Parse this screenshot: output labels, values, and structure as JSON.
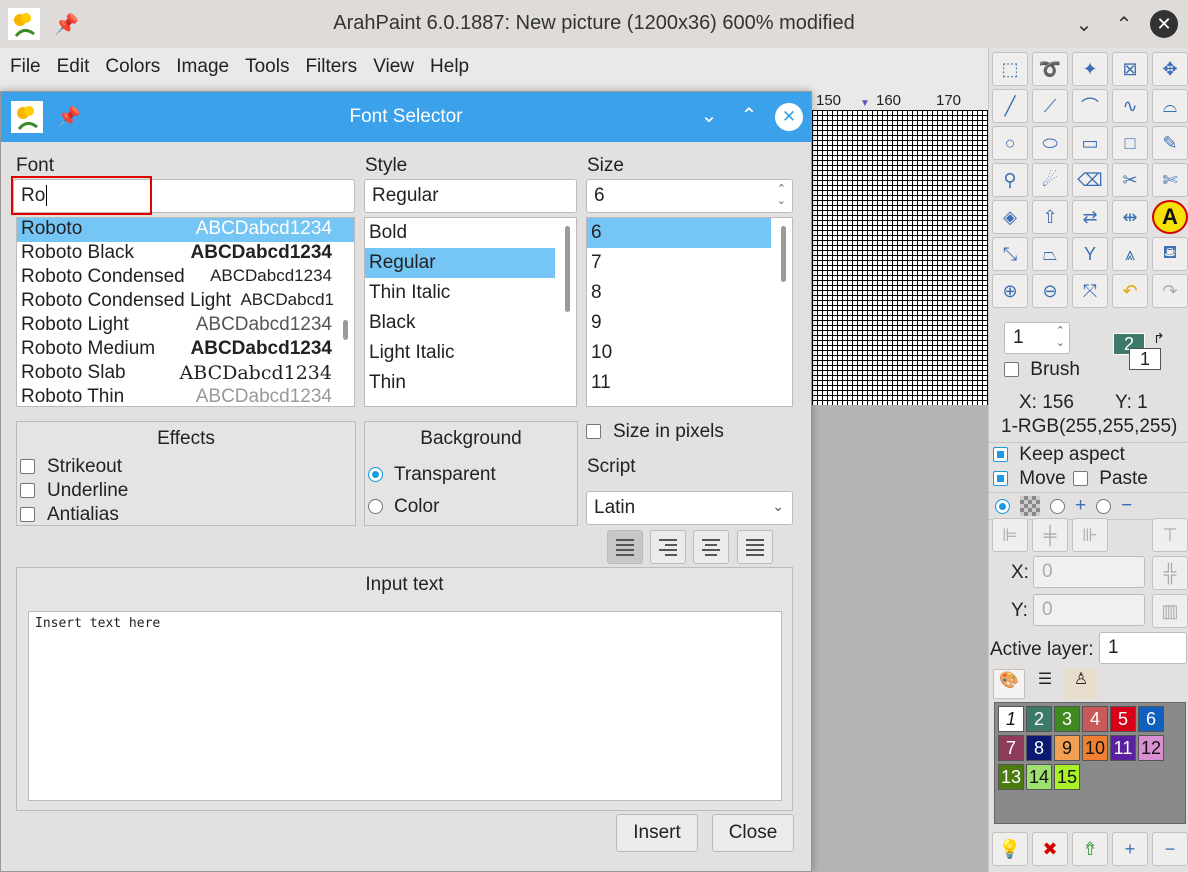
{
  "app": {
    "title": "ArahPaint 6.0.1887: New picture (1200x36) 600% modified",
    "menu": [
      "File",
      "Edit",
      "Colors",
      "Image",
      "Tools",
      "Filters",
      "View",
      "Help"
    ]
  },
  "ruler": {
    "ticks": [
      "150",
      "160",
      "170"
    ]
  },
  "dialog": {
    "title": "Font Selector",
    "font": {
      "label": "Font",
      "value": "Ro",
      "items": [
        {
          "name": "Roboto",
          "sample": "ABCDabcd1234"
        },
        {
          "name": "Roboto Black",
          "sample": "ABCDabcd1234"
        },
        {
          "name": "Roboto Condensed",
          "sample": "ABCDabcd1234"
        },
        {
          "name": "Roboto Condensed Light",
          "sample": "ABCDabcd1"
        },
        {
          "name": "Roboto Light",
          "sample": "ABCDabcd1234"
        },
        {
          "name": "Roboto Medium",
          "sample": "ABCDabcd1234"
        },
        {
          "name": "Roboto Slab",
          "sample": "ABCDabcd1234"
        },
        {
          "name": "Roboto Thin",
          "sample": "ABCDabcd1234"
        }
      ]
    },
    "style": {
      "label": "Style",
      "value": "Regular",
      "items": [
        "Bold",
        "Regular",
        "Thin Italic",
        "Black",
        "Light Italic",
        "Thin"
      ]
    },
    "size": {
      "label": "Size",
      "value": "6",
      "items": [
        "6",
        "7",
        "8",
        "9",
        "10",
        "11"
      ]
    },
    "effects": {
      "title": "Effects",
      "items": [
        "Strikeout",
        "Underline",
        "Antialias"
      ]
    },
    "background": {
      "title": "Background",
      "options": [
        "Transparent",
        "Color"
      ],
      "selected": "Transparent"
    },
    "size_in_pixels": "Size in pixels",
    "script": {
      "label": "Script",
      "value": "Latin"
    },
    "input_text": {
      "title": "Input text",
      "value": "Insert text here"
    },
    "buttons": {
      "insert": "Insert",
      "close": "Close"
    }
  },
  "tools": {
    "brush_size": "1",
    "brush_label": "Brush",
    "fg_color": "2",
    "bg_color": "1",
    "coords": {
      "x": "X: 156",
      "y": "Y: 1"
    },
    "color_readout": "1-RGB(255,255,255)",
    "keep_aspect": "Keep aspect",
    "move": "Move",
    "paste": "Paste",
    "x_label": "X:",
    "x_value": "0",
    "y_label": "Y:",
    "y_value": "0",
    "active_layer_label": "Active layer:",
    "active_layer": "1",
    "palette": [
      {
        "n": "1",
        "color": "#ffffff"
      },
      {
        "n": "2",
        "color": "#3d7a6a"
      },
      {
        "n": "3",
        "color": "#3f8a20"
      },
      {
        "n": "4",
        "color": "#c85a5a"
      },
      {
        "n": "5",
        "color": "#d80018"
      },
      {
        "n": "6",
        "color": "#1060c0"
      },
      {
        "n": "7",
        "color": "#8e3a5a"
      },
      {
        "n": "8",
        "color": "#0a1a70"
      },
      {
        "n": "9",
        "color": "#f0a050"
      },
      {
        "n": "10",
        "color": "#f08030"
      },
      {
        "n": "11",
        "color": "#5a20a0"
      },
      {
        "n": "12",
        "color": "#d890d0"
      },
      {
        "n": "13",
        "color": "#4a7a10"
      },
      {
        "n": "14",
        "color": "#a0e070"
      },
      {
        "n": "15",
        "color": "#a8f028"
      }
    ]
  }
}
